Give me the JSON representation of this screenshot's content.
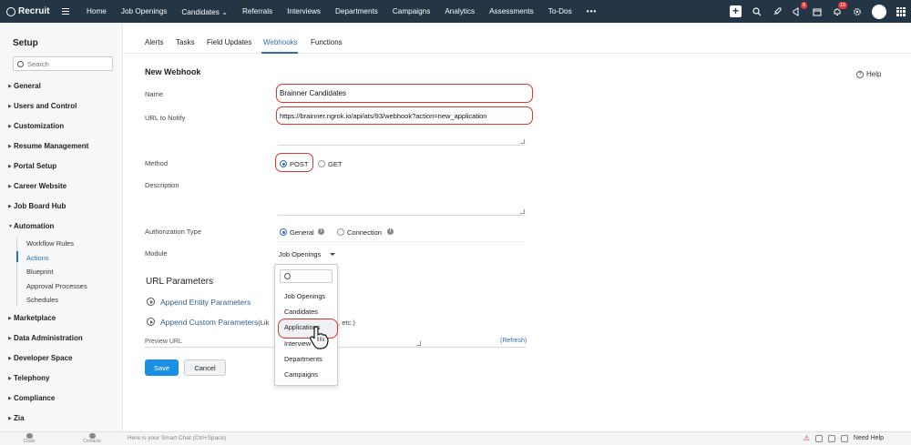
{
  "app": {
    "name": "Recruit"
  },
  "nav": {
    "items": [
      "Home",
      "Job Openings",
      "Candidates ⌄",
      "Referrals",
      "Interviews",
      "Departments",
      "Campaigns",
      "Analytics",
      "Assessments",
      "To-Dos"
    ],
    "more": "•••"
  },
  "top_right": {
    "add": "+",
    "notif_badge_1": "6",
    "notif_badge_2": "10"
  },
  "sidebar": {
    "title": "Setup",
    "search_placeholder": "Search",
    "sections": [
      {
        "label": "General",
        "expanded": false
      },
      {
        "label": "Users and Control",
        "expanded": false
      },
      {
        "label": "Customization",
        "expanded": false
      },
      {
        "label": "Resume Management",
        "expanded": false
      },
      {
        "label": "Portal Setup",
        "expanded": false
      },
      {
        "label": "Career Website",
        "expanded": false
      },
      {
        "label": "Job Board Hub",
        "expanded": false
      },
      {
        "label": "Automation",
        "expanded": true
      },
      {
        "label": "Marketplace",
        "expanded": false
      },
      {
        "label": "Data Administration",
        "expanded": false
      },
      {
        "label": "Developer Space",
        "expanded": false
      },
      {
        "label": "Telephony",
        "expanded": false
      },
      {
        "label": "Compliance",
        "expanded": false
      },
      {
        "label": "Zia",
        "expanded": false
      }
    ],
    "automation_items": [
      "Workflow Rules",
      "Actions",
      "Blueprint",
      "Approval Processes",
      "Schedules"
    ],
    "active_item": "Actions"
  },
  "tabs": {
    "items": [
      "Alerts",
      "Tasks",
      "Field Updates",
      "Webhooks",
      "Functions"
    ],
    "active": "Webhooks"
  },
  "help": {
    "label": "Help"
  },
  "form": {
    "title": "New Webhook",
    "name_label": "Name",
    "name_value": "Brainner Candidates",
    "url_label": "URL to Notify",
    "url_value": "https://brainner.ngrok.io/api/ats/93/webhook?action=new_application",
    "method_label": "Method",
    "method_options": [
      "POST",
      "GET"
    ],
    "method_selected": "POST",
    "description_label": "Description",
    "auth_label": "Authorization Type",
    "auth_options": [
      "General",
      "Connection"
    ],
    "auth_selected": "General",
    "module_label": "Module",
    "module_value": "Job Openings",
    "url_params_title": "URL Parameters",
    "append_entity": "Append Entity Parameters",
    "append_custom": "Append Custom Parameters",
    "append_custom_hint_left": "(Lik",
    "append_custom_hint_right": "t, etc.)",
    "preview_label": "Preview URL",
    "refresh": "(Refresh)",
    "save": "Save",
    "cancel": "Cancel"
  },
  "dropdown": {
    "options": [
      "Job Openings",
      "Candidates",
      "Applications",
      "Interview",
      "Departments",
      "Campaigns"
    ],
    "highlighted": "Applications"
  },
  "bottombar": {
    "chats": "Chats",
    "contacts": "Contacts",
    "smart_chat": "Here is your Smart Chat (Ctrl+Space)",
    "need_help": "Need Help"
  }
}
